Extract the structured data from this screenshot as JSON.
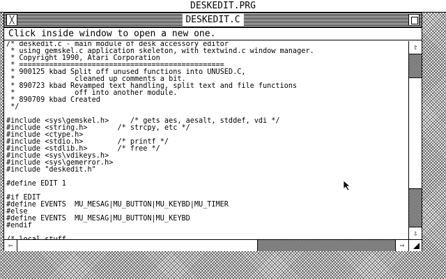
{
  "desktop": {
    "title": "DESKEDIT.PRG"
  },
  "window": {
    "title": "DESKEDIT.C",
    "info_line": "Click inside window to open a new one.",
    "close_icon": "close-icon",
    "full_icon": "full-icon",
    "code_lines": [
      "/* deskedit.c - main module of desk accessory editor",
      " * using gemskel.c application skeleton, with textwind.c window manager.",
      " * Copyright 1990, Atari Corporation",
      " * ================================================",
      " * 900125 kbad Split off unused functions into UNUSED.C,",
      " *              cleaned up comments a bit.",
      " * 890723 kbad Revamped text handling, split text and file functions",
      " *              off into another module.",
      " * 890709 kbad Created",
      " */",
      "",
      "#include <sys\\gemskel.h>     /* gets aes, aesalt, stddef, vdi */",
      "#include <string.h>       /* strcpy, etc */",
      "#include <ctype.h>",
      "#include <stdio.h>        /* printf */",
      "#include <stdlib.h>       /* free */",
      "#include <sys\\vdikeys.h>",
      "#include <sys\\gemerror.h>",
      "#include \"deskedit.h\"",
      "",
      "#define EDIT 1",
      "",
      "#if EDIT",
      "#define EVENTS  MU_MESAG|MU_BUTTON|MU_KEYBD|MU_TIMER",
      "#else",
      "#define EVENTS  MU_MESAG|MU_BUTTON|MU_KEYBD",
      "#endif",
      "",
      "/* local stuff"
    ]
  },
  "scroll": {
    "up_icon": "⇧",
    "down_icon": "⇩",
    "left_icon": "⇦",
    "right_icon": "⇨"
  }
}
